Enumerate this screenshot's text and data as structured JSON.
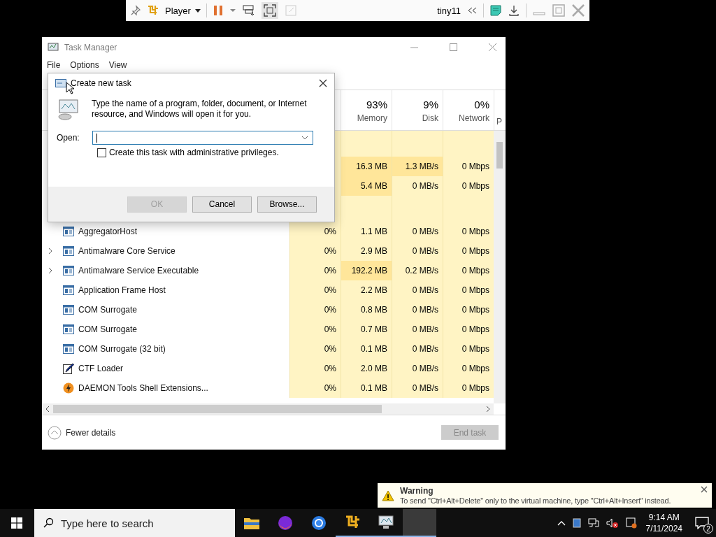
{
  "vm_toolbar": {
    "menu": "Player",
    "vm_name": "tiny11"
  },
  "task_manager": {
    "title": "Task Manager",
    "menu": [
      "File",
      "Options",
      "View"
    ],
    "columns": [
      {
        "percent": "93%",
        "label": "Memory"
      },
      {
        "percent": "9%",
        "label": "Disk"
      },
      {
        "percent": "0%",
        "label": "Network"
      }
    ],
    "column_6": "P",
    "rows": [
      {
        "kind": "group"
      },
      {
        "kind": "covered",
        "memory": {
          "text": "16.3 MB",
          "hot": true
        },
        "disk": {
          "text": "1.3 MB/s",
          "hot": true
        },
        "network": {
          "text": "0 Mbps",
          "hot": false
        }
      },
      {
        "kind": "covered",
        "memory": {
          "text": "5.4 MB",
          "hot": true
        },
        "disk": {
          "text": "0 MB/s",
          "hot": false
        },
        "network": {
          "text": "0 Mbps",
          "hot": false
        }
      },
      {
        "kind": "group"
      },
      {
        "kind": "service",
        "expandable": false,
        "name": "AggregatorHost",
        "cpu": "0%",
        "memory": {
          "text": "1.1 MB",
          "hot": false
        },
        "disk": {
          "text": "0 MB/s",
          "hot": false
        },
        "network": {
          "text": "0 Mbps",
          "hot": false
        }
      },
      {
        "kind": "service",
        "expandable": true,
        "name": "Antimalware Core Service",
        "cpu": "0%",
        "memory": {
          "text": "2.9 MB",
          "hot": false
        },
        "disk": {
          "text": "0 MB/s",
          "hot": false
        },
        "network": {
          "text": "0 Mbps",
          "hot": false
        }
      },
      {
        "kind": "service",
        "expandable": true,
        "name": "Antimalware Service Executable",
        "cpu": "0%",
        "memory": {
          "text": "192.2 MB",
          "hot": true
        },
        "disk": {
          "text": "0.2 MB/s",
          "hot": false
        },
        "network": {
          "text": "0 Mbps",
          "hot": false
        }
      },
      {
        "kind": "service",
        "expandable": false,
        "name": "Application Frame Host",
        "cpu": "0%",
        "memory": {
          "text": "2.2 MB",
          "hot": false
        },
        "disk": {
          "text": "0 MB/s",
          "hot": false
        },
        "network": {
          "text": "0 Mbps",
          "hot": false
        }
      },
      {
        "kind": "service",
        "expandable": false,
        "name": "COM Surrogate",
        "cpu": "0%",
        "memory": {
          "text": "0.8 MB",
          "hot": false
        },
        "disk": {
          "text": "0 MB/s",
          "hot": false
        },
        "network": {
          "text": "0 Mbps",
          "hot": false
        }
      },
      {
        "kind": "service",
        "expandable": false,
        "name": "COM Surrogate",
        "cpu": "0%",
        "memory": {
          "text": "0.7 MB",
          "hot": false
        },
        "disk": {
          "text": "0 MB/s",
          "hot": false
        },
        "network": {
          "text": "0 Mbps",
          "hot": false
        }
      },
      {
        "kind": "service",
        "expandable": false,
        "name": "COM Surrogate (32 bit)",
        "cpu": "0%",
        "memory": {
          "text": "0.1 MB",
          "hot": false
        },
        "disk": {
          "text": "0 MB/s",
          "hot": false
        },
        "network": {
          "text": "0 Mbps",
          "hot": false
        }
      },
      {
        "kind": "pen",
        "expandable": false,
        "name": "CTF Loader",
        "cpu": "0%",
        "memory": {
          "text": "2.0 MB",
          "hot": false
        },
        "disk": {
          "text": "0 MB/s",
          "hot": false
        },
        "network": {
          "text": "0 Mbps",
          "hot": false
        }
      },
      {
        "kind": "bolt",
        "expandable": false,
        "name": "DAEMON Tools Shell Extensions...",
        "cpu": "0%",
        "memory": {
          "text": "0.1 MB",
          "hot": false
        },
        "disk": {
          "text": "0 MB/s",
          "hot": false
        },
        "network": {
          "text": "0 Mbps",
          "hot": false
        }
      }
    ],
    "fewer_details": "Fewer details",
    "end_task": {
      "label": "End task",
      "disabled": true
    }
  },
  "dialog": {
    "title": "Create new task",
    "description": "Type the name of a program, folder, document, or Internet resource, and Windows will open it for you.",
    "open_label": "Open:",
    "admin_checkbox": {
      "label": "Create this task with administrative privileges.",
      "checked": false
    },
    "buttons": [
      {
        "label": "OK",
        "disabled": true
      },
      {
        "label": "Cancel",
        "disabled": false
      },
      {
        "label": "Browse...",
        "disabled": false
      }
    ]
  },
  "toast": {
    "title": "Warning",
    "message": "To send \"Ctrl+Alt+Delete\" only to the virtual machine, type \"Ctrl+Alt+Insert\" instead."
  },
  "taskbar": {
    "search_placeholder": "Type here to search",
    "time": "9:14 AM",
    "date": "7/11/2024",
    "notification_count": "2"
  }
}
